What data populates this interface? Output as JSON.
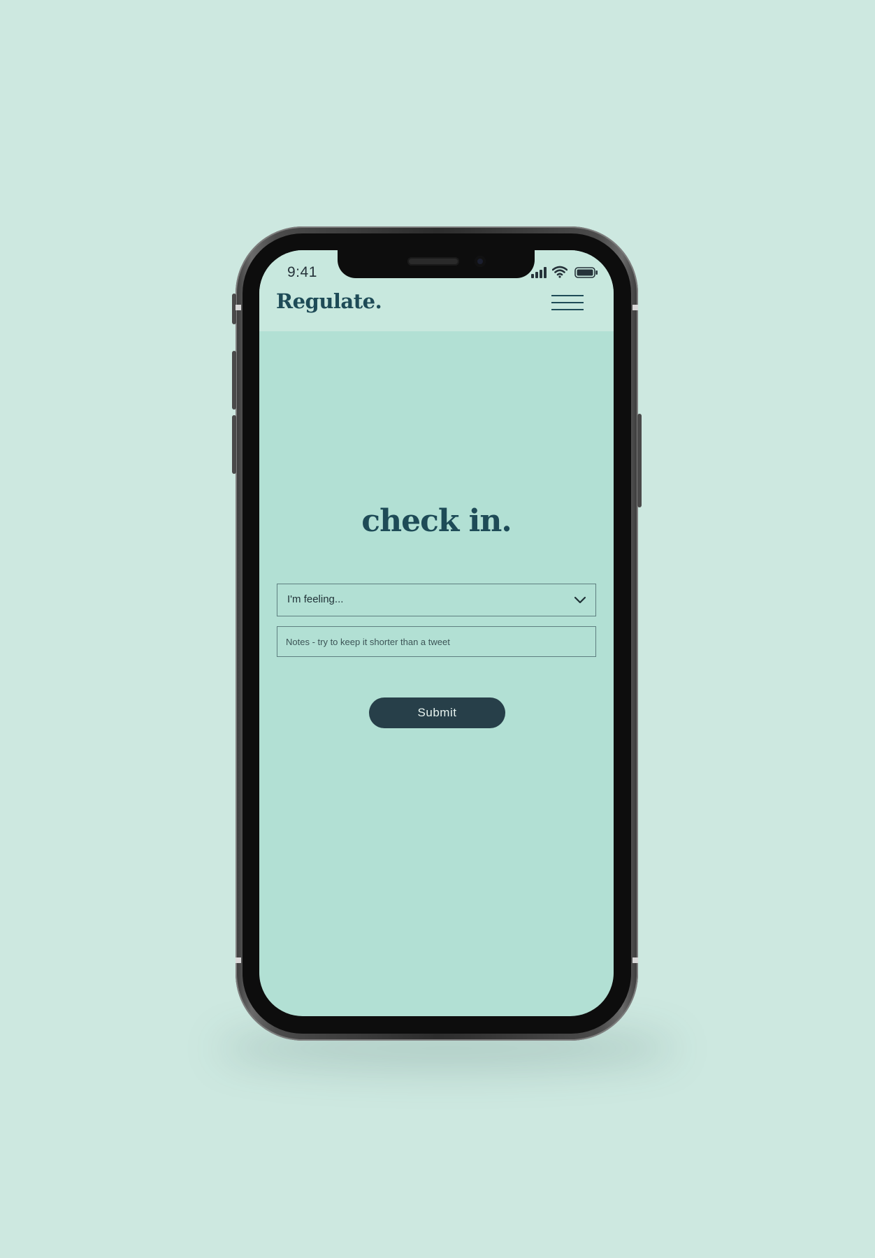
{
  "colors": {
    "background": "#cde8e0",
    "header": "#c8e8de",
    "screen": "#b2e0d4",
    "primary": "#1e4b57",
    "button": "#273f49"
  },
  "status_bar": {
    "time": "9:41",
    "icons": [
      "signal-icon",
      "wifi-icon",
      "battery-icon"
    ]
  },
  "header": {
    "logo": "Regulate.",
    "menu_icon": "hamburger-menu-icon"
  },
  "main": {
    "title": "check in.",
    "feeling_select": {
      "selected": "I'm feeling...",
      "icon": "chevron-down-icon"
    },
    "notes": {
      "placeholder": "Notes - try to keep it shorter than a tweet",
      "value": ""
    },
    "submit_label": "Submit"
  }
}
